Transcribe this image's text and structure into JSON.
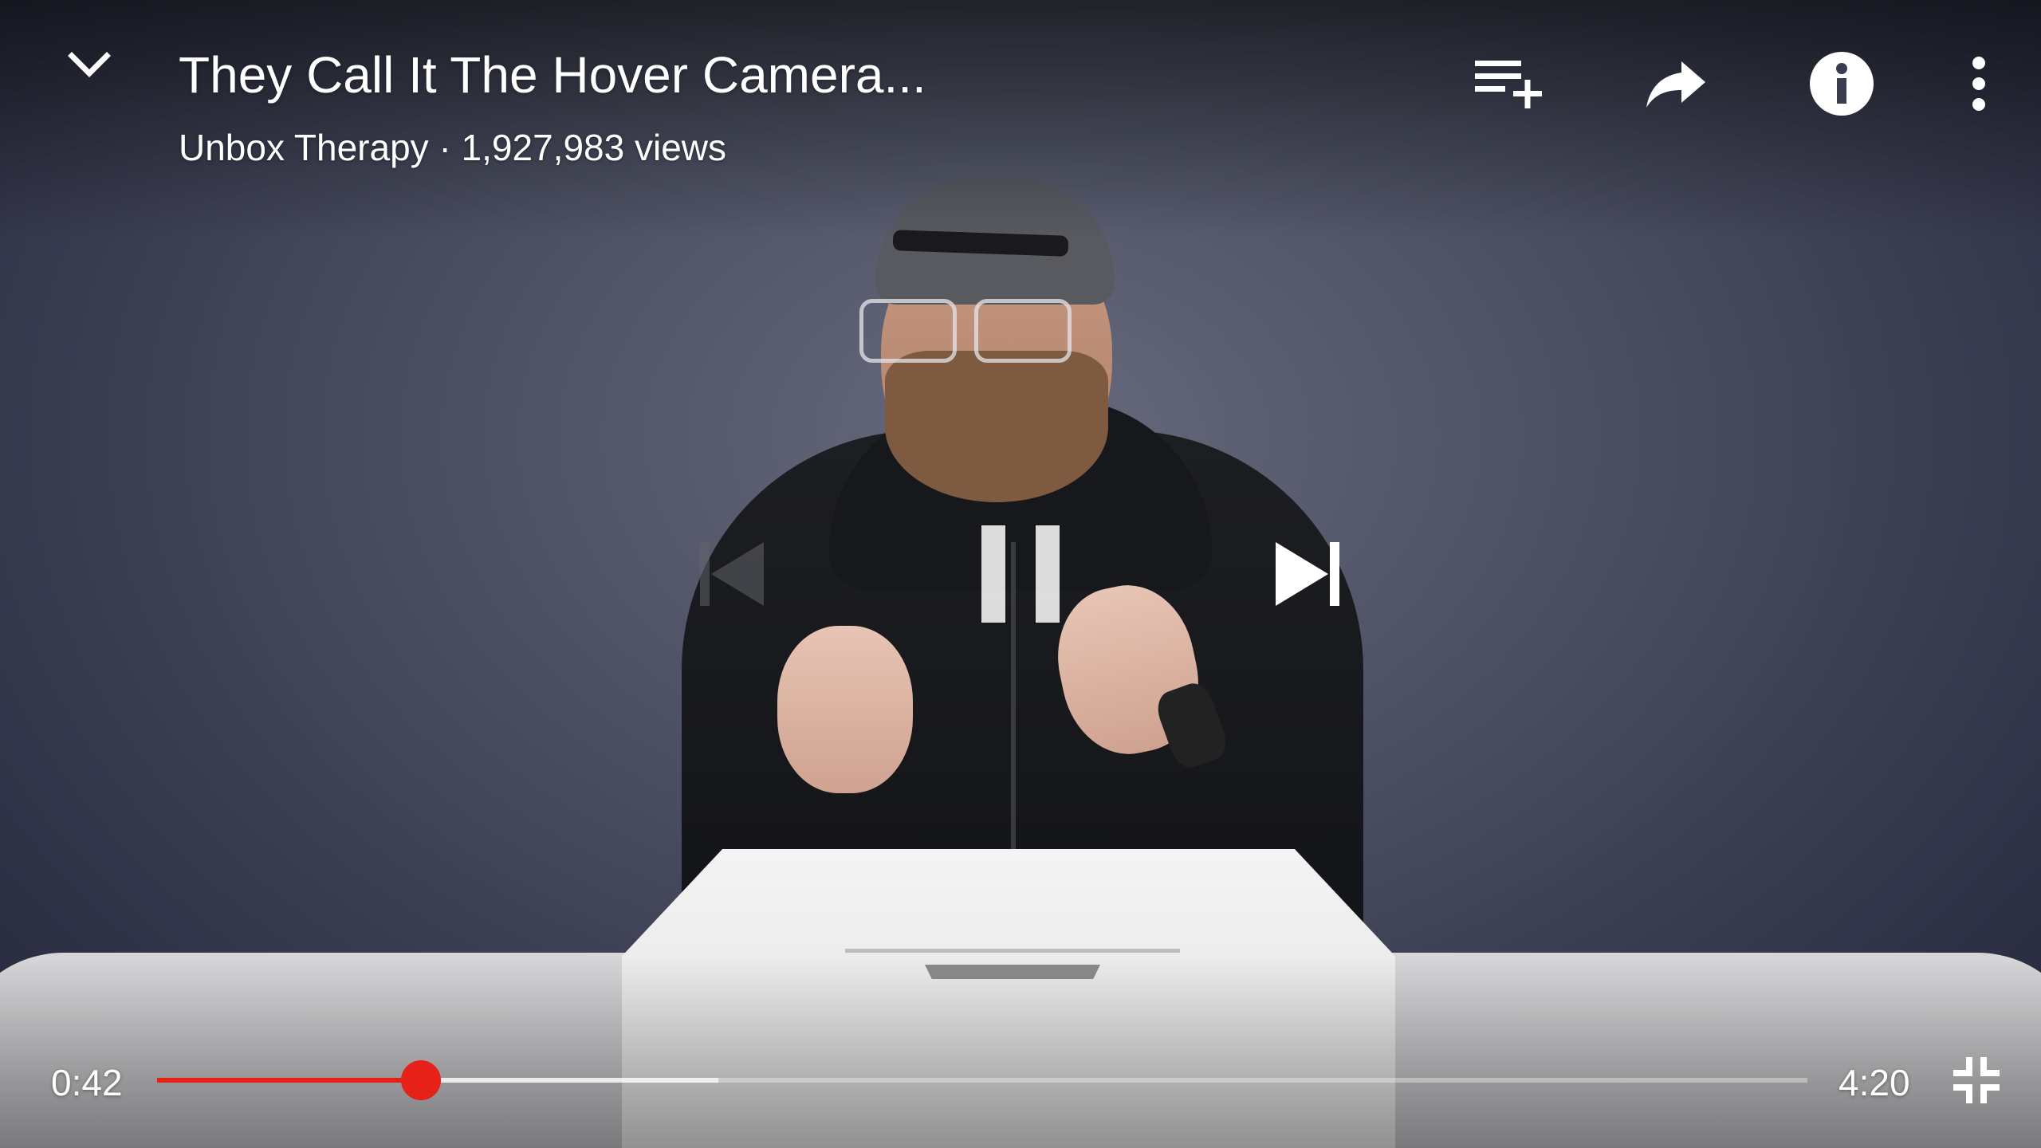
{
  "video": {
    "title": "They Call It The Hover Camera...",
    "channel_views": "Unbox Therapy · 1,927,983 views"
  },
  "controls": {
    "top": [
      {
        "name": "add-to-playlist-icon"
      },
      {
        "name": "share-icon"
      },
      {
        "name": "info-icon"
      },
      {
        "name": "more-options-icon"
      }
    ],
    "center": [
      "previous-icon",
      "pause-icon",
      "next-icon"
    ],
    "collapse_icon": "chevron-down-icon",
    "fullscreen_icon": "exit-fullscreen-icon"
  },
  "playback": {
    "current_time": "0:42",
    "duration": "4:20",
    "progress_fraction": 0.16,
    "buffered_fraction": 0.34
  },
  "colors": {
    "progress": "#e62117",
    "controls": "#ffffff"
  }
}
